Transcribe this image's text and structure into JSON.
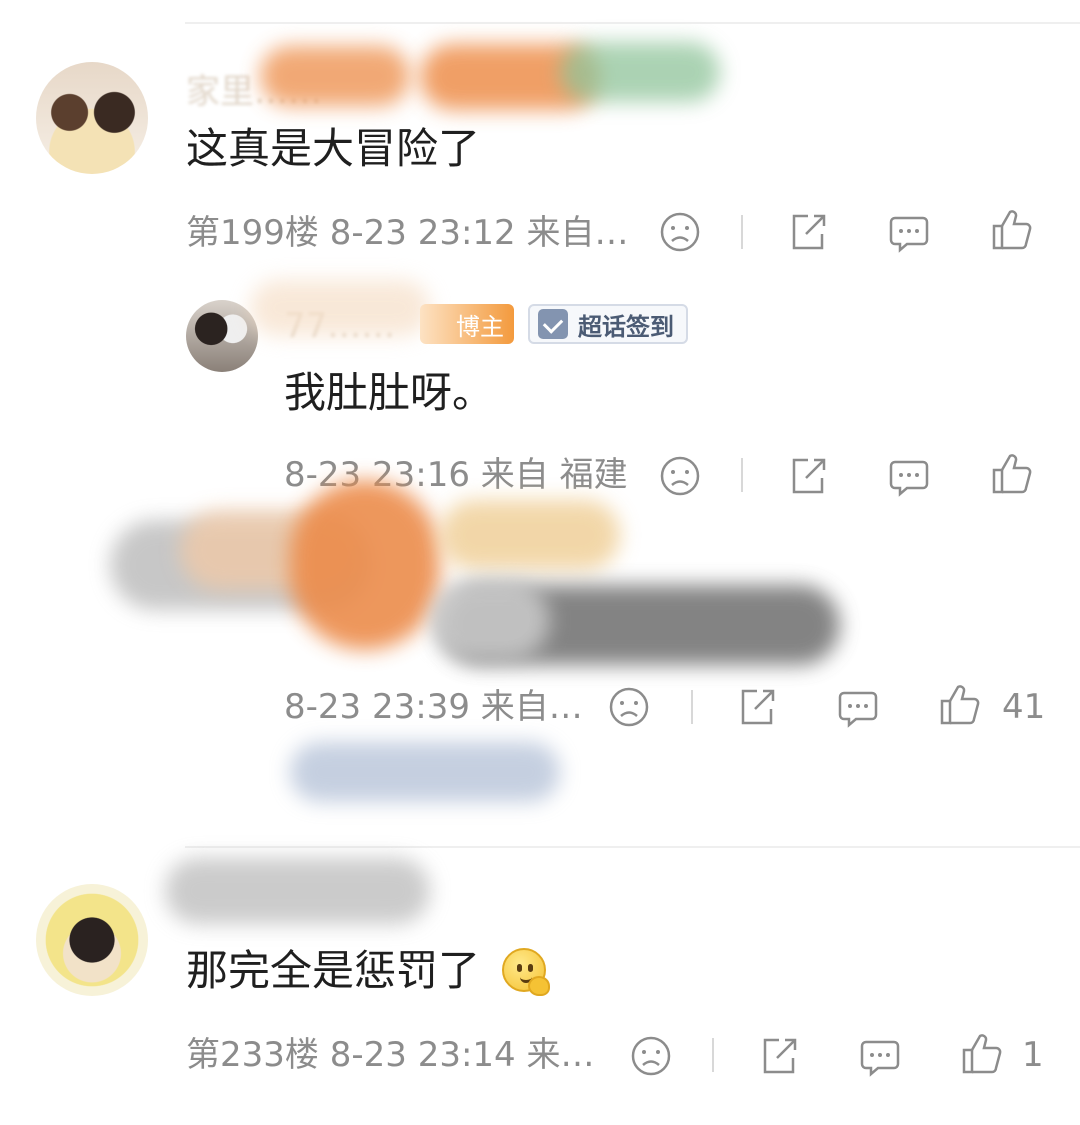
{
  "comments": [
    {
      "username": "家里……",
      "text": "这真是大冒险了",
      "floor": "第199楼",
      "time": "8-23 23:12",
      "location": "来自…"
    },
    {
      "reply1": {
        "username": "77……",
        "badge_host": "博主",
        "badge_sign": "超话签到",
        "text": "我肚肚呀。",
        "time": "8-23 23:16",
        "location": "来自 福建"
      },
      "reply2": {
        "time": "8-23 23:39",
        "location": "来自…",
        "likes": "41"
      }
    },
    {
      "username": "",
      "text": "那完全是惩罚了",
      "floor": "第233楼",
      "time": "8-23 23:14",
      "location": "来…",
      "likes": "1"
    }
  ],
  "icons": [
    "dislike-icon",
    "share-icon",
    "comment-icon",
    "like-icon"
  ],
  "colors": {
    "meta_text": "#8c8c8c",
    "content_text": "#1f1f1f",
    "divider": "#efefef"
  }
}
